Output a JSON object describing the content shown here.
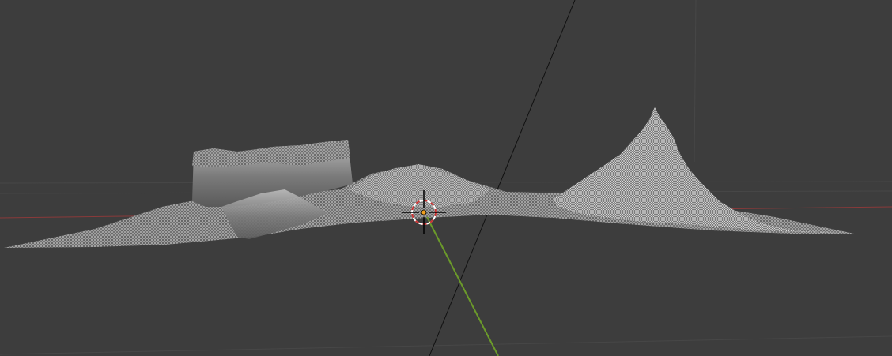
{
  "viewport": {
    "background_color": "#3d3d3d",
    "grid_color": "#484848",
    "x_axis_color": "#8a3a3a",
    "y_axis_color": "#6b9a2a",
    "mesh_base_color": "#6e6e6e",
    "mesh_highlight_color": "#d9d9d9",
    "object_origin_color": "#f0a020"
  },
  "cursor_3d": {
    "icon": "3d-cursor-icon",
    "ring_colors": [
      "#c83232",
      "#ffffff"
    ]
  }
}
